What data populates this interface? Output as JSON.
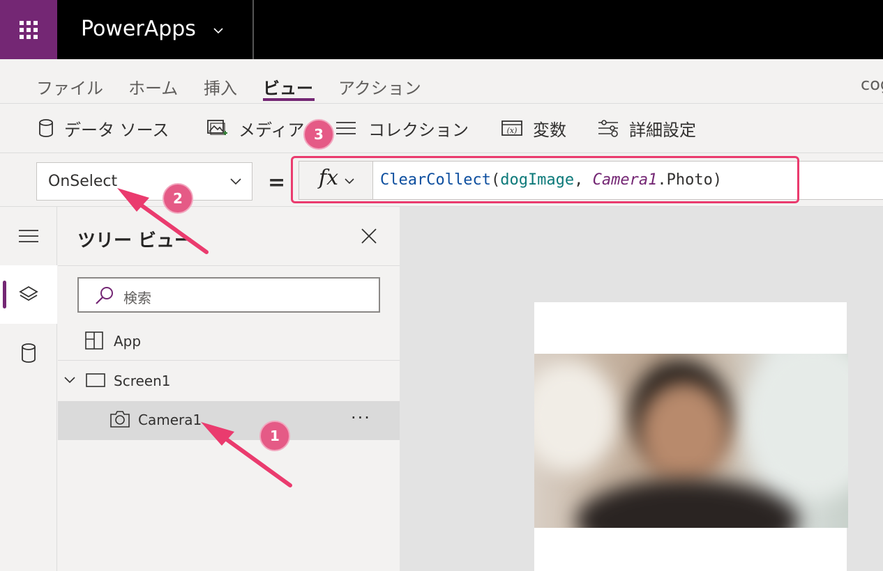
{
  "app": {
    "name": "PowerApps",
    "user_partial": "cog"
  },
  "menu": {
    "tabs": [
      {
        "label": "ファイル",
        "active": false
      },
      {
        "label": "ホーム",
        "active": false
      },
      {
        "label": "挿入",
        "active": false
      },
      {
        "label": "ビュー",
        "active": true
      },
      {
        "label": "アクション",
        "active": false
      }
    ]
  },
  "ribbon": {
    "items": [
      {
        "label": "データ ソース",
        "icon": "database-icon"
      },
      {
        "label": "メディア",
        "icon": "media-icon"
      },
      {
        "label": "コレクション",
        "icon": "collection-icon"
      },
      {
        "label": "変数",
        "icon": "variable-icon"
      },
      {
        "label": "詳細設定",
        "icon": "settings-sliders-icon"
      }
    ]
  },
  "formula_bar": {
    "property": "OnSelect",
    "equals": "=",
    "fx": "fx",
    "formula": {
      "fn": "ClearCollect",
      "open": "(",
      "arg1": "dogImage",
      "comma": ", ",
      "ctl": "Camera1",
      "prop": ".Photo",
      "close": ")"
    }
  },
  "tree_view": {
    "title": "ツリー ビュー",
    "search_placeholder": "検索",
    "items": [
      {
        "label": "App"
      },
      {
        "label": "Screen1"
      },
      {
        "label": "Camera1",
        "selected": true
      }
    ],
    "more": "···"
  },
  "annotations": {
    "badges": [
      "1",
      "2",
      "3"
    ],
    "color": "#ea3b6e"
  },
  "colors": {
    "brand": "#742774",
    "topbar": "#000000"
  }
}
